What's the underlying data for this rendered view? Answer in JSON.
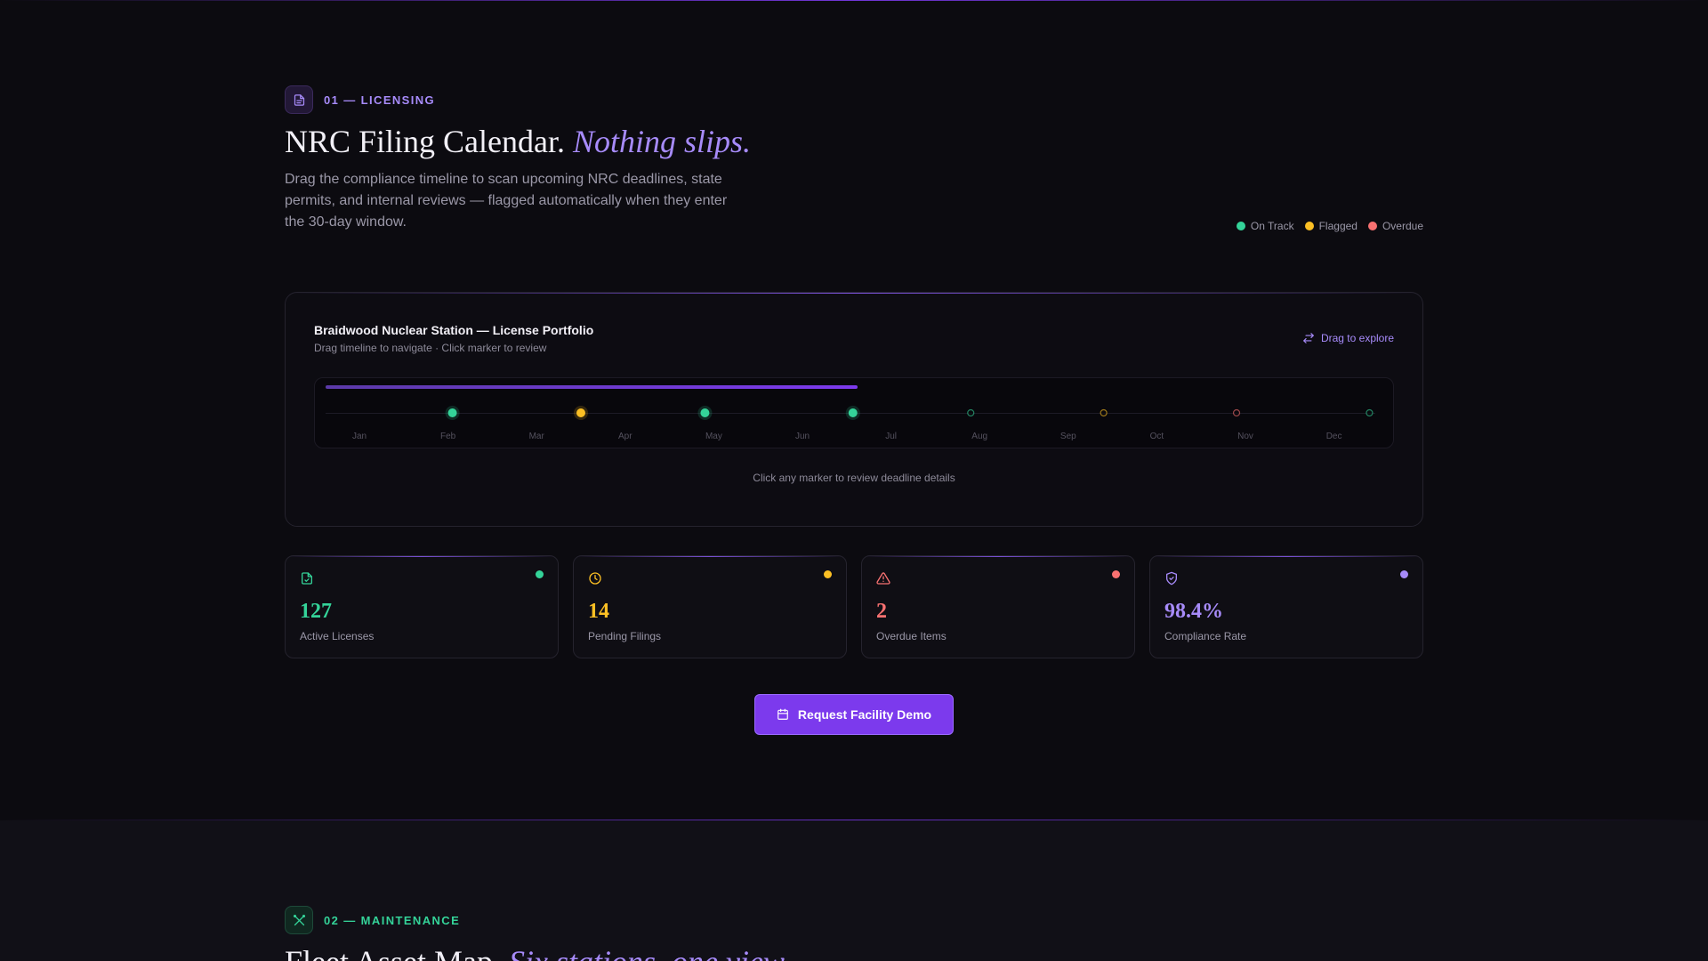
{
  "colors": {
    "accent": "#a78bfa",
    "button": "#7c3aed",
    "on_track": "#34d399",
    "flagged": "#fbbf24",
    "overdue": "#f87171",
    "muted_marker": "#2d6b63"
  },
  "section1": {
    "eyebrow": {
      "icon": "document-icon",
      "label": "01 — LICENSING"
    },
    "headline": {
      "main": "NRC Filing Calendar.",
      "accent": "Nothing slips."
    },
    "description": "Drag the compliance timeline to scan upcoming NRC deadlines, state permits, and internal reviews — flagged automatically when they enter the 30-day window.",
    "legend": [
      {
        "label": "On Track",
        "color": "#34d399"
      },
      {
        "label": "Flagged",
        "color": "#fbbf24"
      },
      {
        "label": "Overdue",
        "color": "#f87171"
      }
    ],
    "panel": {
      "title": "Braidwood Nuclear Station — License Portfolio",
      "subtitle": "Drag timeline to navigate · Click marker to review",
      "drag_label": "Drag to explore",
      "hint": "Click any marker to review deadline details"
    },
    "timeline": {
      "months": [
        "Jan",
        "Feb",
        "Mar",
        "Apr",
        "May",
        "Jun",
        "Jul",
        "Aug",
        "Sep",
        "Oct",
        "Nov",
        "Dec"
      ],
      "progress": 0.5,
      "markers": [
        {
          "month": 1.05,
          "status": "on_track",
          "style": "filled"
        },
        {
          "month": 2.5,
          "status": "flagged",
          "style": "filled"
        },
        {
          "month": 3.9,
          "status": "on_track",
          "style": "filled"
        },
        {
          "month": 5.57,
          "status": "on_track",
          "style": "filled"
        },
        {
          "month": 6.9,
          "status": "on_track",
          "style": "outline"
        },
        {
          "month": 8.4,
          "status": "flagged",
          "style": "outline"
        },
        {
          "month": 9.9,
          "status": "overdue",
          "style": "outline"
        },
        {
          "month": 11.4,
          "status": "on_track",
          "style": "outline"
        }
      ]
    },
    "stats": [
      {
        "icon": "file-check-icon",
        "value": "127",
        "label": "Active Licenses",
        "color": "#34d399"
      },
      {
        "icon": "clock-icon",
        "value": "14",
        "label": "Pending Filings",
        "color": "#fbbf24"
      },
      {
        "icon": "alert-triangle-icon",
        "value": "2",
        "label": "Overdue Items",
        "color": "#f87171"
      },
      {
        "icon": "shield-check-icon",
        "value": "98.4%",
        "label": "Compliance Rate",
        "color": "#a78bfa"
      }
    ],
    "cta": {
      "icon": "calendar-icon",
      "label": "Request Facility Demo"
    }
  },
  "section2": {
    "eyebrow": {
      "icon": "tools-icon",
      "label": "02 — MAINTENANCE"
    },
    "headline": {
      "main": "Fleet Asset Map.",
      "accent": "Six stations, one view."
    }
  }
}
